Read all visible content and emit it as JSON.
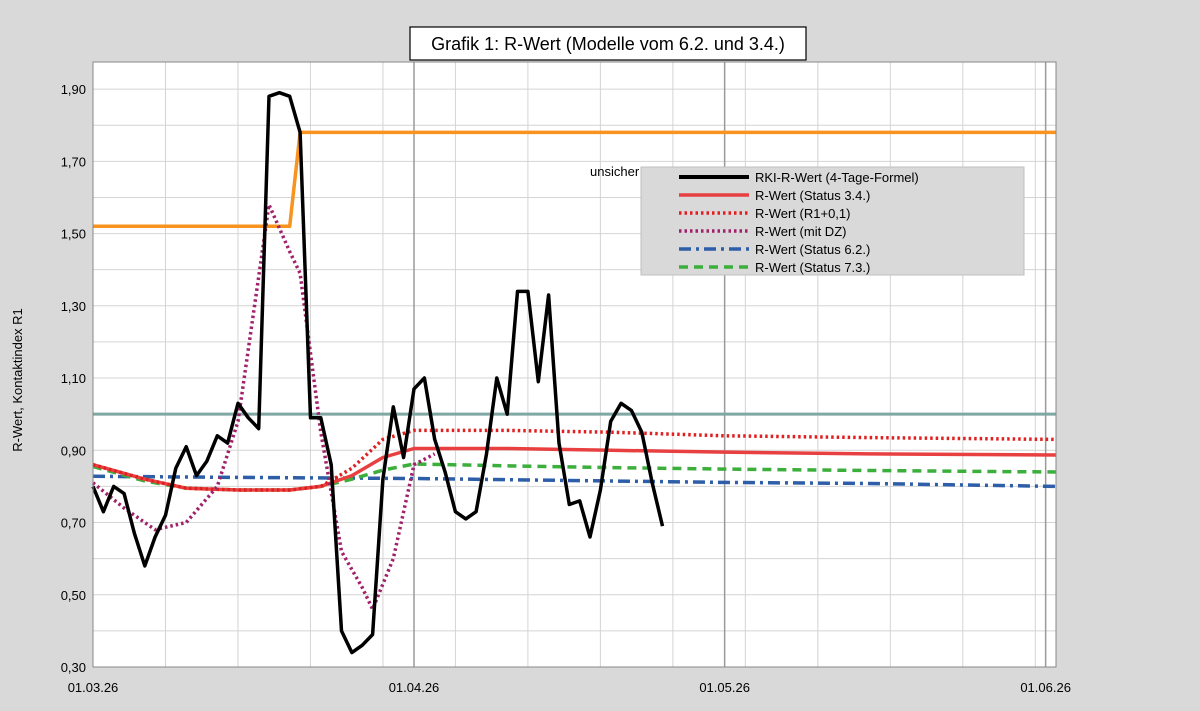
{
  "chart_data": {
    "type": "line",
    "title": "Grafik 1: R-Wert (Modelle vom 6.2. und 3.4.)",
    "ylabel": "R-Wert, Kontaktindex R1",
    "xlabel": "",
    "ylim": [
      0.3,
      1.9
    ],
    "y_ticks": [
      "0,30",
      "0,50",
      "0,70",
      "0,90",
      "1,10",
      "1,30",
      "1,50",
      "1,70",
      "1,90"
    ],
    "x_range": [
      "2026-03-01",
      "2026-06-02"
    ],
    "x_tick_labels": [
      {
        "date": "2026-03-01",
        "label": "01.03.26"
      },
      {
        "date": "2026-04-01",
        "label": "01.04.26"
      },
      {
        "date": "2026-05-01",
        "label": "01.05.26"
      },
      {
        "date": "2026-06-01",
        "label": "01.06.26"
      }
    ],
    "grid": true,
    "legend_position": "right-middle",
    "reference_line": {
      "y": 1.0,
      "color": "#7fa8a4"
    },
    "annotation": {
      "text": "unsicher",
      "date": "2026-04-18",
      "y": 1.66
    },
    "series": [
      {
        "name": "RKI-R-Wert (4-Tage-Formel)",
        "color": "#000000",
        "style": "solid",
        "x": [
          "2026-03-01",
          "2026-03-02",
          "2026-03-03",
          "2026-03-04",
          "2026-03-05",
          "2026-03-06",
          "2026-03-07",
          "2026-03-08",
          "2026-03-09",
          "2026-03-10",
          "2026-03-11",
          "2026-03-12",
          "2026-03-13",
          "2026-03-14",
          "2026-03-15",
          "2026-03-16",
          "2026-03-17",
          "2026-03-18",
          "2026-03-19",
          "2026-03-20",
          "2026-03-21",
          "2026-03-22",
          "2026-03-23",
          "2026-03-24",
          "2026-03-25",
          "2026-03-26",
          "2026-03-27",
          "2026-03-28",
          "2026-03-29",
          "2026-03-30",
          "2026-03-31",
          "2026-04-01",
          "2026-04-02",
          "2026-04-03",
          "2026-04-04",
          "2026-04-05",
          "2026-04-06",
          "2026-04-07",
          "2026-04-08",
          "2026-04-09",
          "2026-04-10",
          "2026-04-11",
          "2026-04-12",
          "2026-04-13",
          "2026-04-14",
          "2026-04-15",
          "2026-04-16",
          "2026-04-17",
          "2026-04-18",
          "2026-04-19",
          "2026-04-20",
          "2026-04-21",
          "2026-04-22",
          "2026-04-23",
          "2026-04-24",
          "2026-04-25",
          "2026-04-26",
          "2026-04-27"
        ],
        "values": [
          0.8,
          0.73,
          0.8,
          0.78,
          0.67,
          0.58,
          0.66,
          0.72,
          0.85,
          0.91,
          0.83,
          0.87,
          0.94,
          0.92,
          1.03,
          0.99,
          0.96,
          1.88,
          1.89,
          1.88,
          1.78,
          0.99,
          0.99,
          0.86,
          0.4,
          0.34,
          0.36,
          0.39,
          0.82,
          1.02,
          0.88,
          1.07,
          1.1,
          0.93,
          0.84,
          0.73,
          0.71,
          0.73,
          0.89,
          1.1,
          1.0,
          1.34,
          1.34,
          1.09,
          1.33,
          0.92,
          0.75,
          0.76,
          0.66,
          0.79,
          0.98,
          1.03,
          1.01,
          0.95,
          0.81,
          0.69,
          null,
          null
        ]
      },
      {
        "name": "R-Wert (Status 3.4.)",
        "color": "#e84040",
        "style": "solid",
        "x": [
          "2026-03-01",
          "2026-03-06",
          "2026-03-10",
          "2026-03-15",
          "2026-03-20",
          "2026-03-23",
          "2026-03-26",
          "2026-03-29",
          "2026-04-01",
          "2026-04-10",
          "2026-04-20",
          "2026-05-01",
          "2026-05-15",
          "2026-06-02"
        ],
        "values": [
          0.86,
          0.82,
          0.795,
          0.79,
          0.79,
          0.8,
          0.83,
          0.88,
          0.905,
          0.905,
          0.9,
          0.895,
          0.89,
          0.887
        ]
      },
      {
        "name": "R-Wert (R1+0,1)",
        "color": "#e02020",
        "style": "dotted",
        "x": [
          "2026-03-01",
          "2026-03-06",
          "2026-03-10",
          "2026-03-15",
          "2026-03-20",
          "2026-03-23",
          "2026-03-26",
          "2026-03-29",
          "2026-04-01",
          "2026-04-10",
          "2026-04-20",
          "2026-05-01",
          "2026-05-15",
          "2026-06-02"
        ],
        "values": [
          0.86,
          0.82,
          0.795,
          0.79,
          0.79,
          0.8,
          0.85,
          0.93,
          0.955,
          0.955,
          0.95,
          0.94,
          0.935,
          0.93
        ]
      },
      {
        "name": "R-Wert (mit DZ)",
        "color": "#a0206a",
        "style": "dotted",
        "x": [
          "2026-03-01",
          "2026-03-04",
          "2026-03-07",
          "2026-03-10",
          "2026-03-13",
          "2026-03-15",
          "2026-03-18",
          "2026-03-20",
          "2026-03-21",
          "2026-03-23",
          "2026-03-25",
          "2026-03-27",
          "2026-03-28",
          "2026-03-30",
          "2026-04-01",
          "2026-04-03"
        ],
        "values": [
          0.81,
          0.74,
          0.68,
          0.7,
          0.8,
          0.98,
          1.58,
          1.45,
          1.39,
          0.95,
          0.62,
          0.52,
          0.46,
          0.6,
          0.86,
          0.89
        ]
      },
      {
        "name": "R-Wert (Status 6.2.)",
        "color": "#2e5ea8",
        "style": "dashdot",
        "x": [
          "2026-03-01",
          "2026-03-15",
          "2026-04-01",
          "2026-04-20",
          "2026-05-01",
          "2026-05-15",
          "2026-06-02"
        ],
        "values": [
          0.828,
          0.825,
          0.822,
          0.815,
          0.811,
          0.808,
          0.8
        ]
      },
      {
        "name": "R-Wert (Status 7.3.)",
        "color": "#3cae3c",
        "style": "dashed",
        "x": [
          "2026-03-01",
          "2026-03-06",
          "2026-03-10",
          "2026-03-15",
          "2026-03-20",
          "2026-03-23",
          "2026-03-26",
          "2026-03-29",
          "2026-04-01",
          "2026-04-10",
          "2026-04-20",
          "2026-05-01",
          "2026-05-15",
          "2026-06-02"
        ],
        "values": [
          0.855,
          0.815,
          0.795,
          0.79,
          0.79,
          0.8,
          0.82,
          0.845,
          0.862,
          0.857,
          0.852,
          0.848,
          0.844,
          0.84
        ]
      },
      {
        "name": "",
        "color": "#f7931e",
        "style": "solid",
        "x": [
          "2026-03-01",
          "2026-03-20",
          "2026-03-21",
          "2026-06-02"
        ],
        "values": [
          1.52,
          1.52,
          1.78,
          1.78
        ]
      }
    ]
  }
}
